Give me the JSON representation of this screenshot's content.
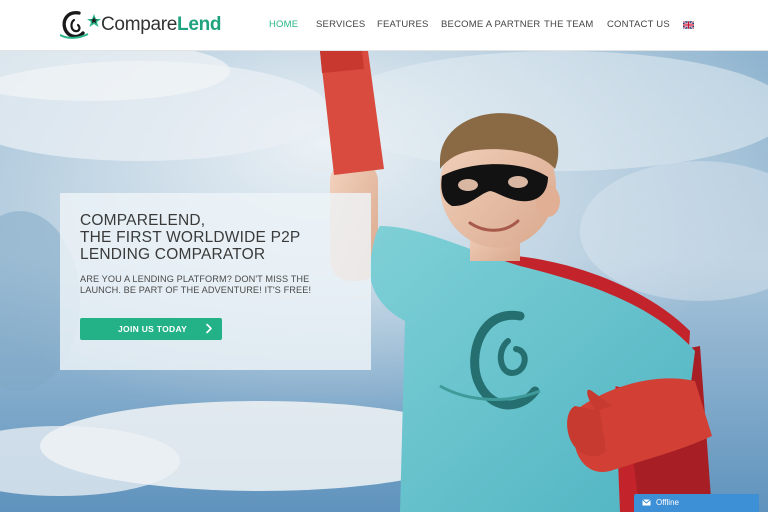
{
  "brand": {
    "name_part1": "Compare",
    "name_part2": "Lend"
  },
  "nav": {
    "items": [
      {
        "label": "HOME",
        "active": true
      },
      {
        "label": "SERVICES",
        "active": false
      },
      {
        "label": "FEATURES",
        "active": false
      },
      {
        "label": "BECOME A PARTNER",
        "active": false
      },
      {
        "label": "THE TEAM",
        "active": false
      },
      {
        "label": "CONTACT US",
        "active": false
      }
    ],
    "language_icon": "uk-flag-icon"
  },
  "hero": {
    "title_line1": "COMPARELEND,",
    "title_line2": "THE FIRST WORLDWIDE P2P",
    "title_line3": "LENDING COMPARATOR",
    "subtitle_line1": "ARE YOU A LENDING PLATFORM? DON'T MISS THE",
    "subtitle_line2": "LAUNCH. BE PART OF THE ADVENTURE! IT'S FREE!",
    "cta_label": "JOIN US TODAY",
    "cta_icon": "chevron-right-icon"
  },
  "chat": {
    "label": "Offline",
    "icon": "envelope-icon"
  },
  "colors": {
    "accent": "#2bb58a",
    "cta": "#23b287",
    "chat": "#3d8fd6",
    "text_dark": "#3a3a3a"
  }
}
